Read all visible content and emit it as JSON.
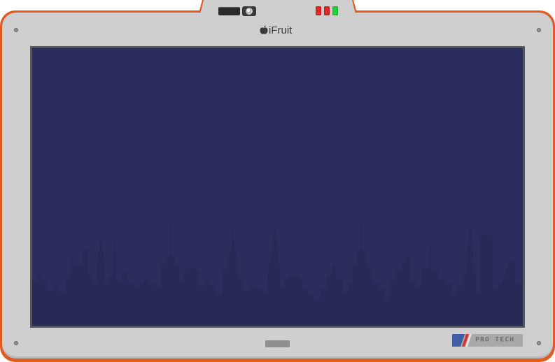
{
  "device": {
    "brand_name": "iFruit",
    "badge_text": "PRO TECH",
    "indicators": [
      "red",
      "red",
      "green"
    ]
  },
  "colors": {
    "rim": "#e05a22",
    "bezel": "#cfcfcf",
    "screen": "#2b2d5c",
    "skyline": "#272a55",
    "led_red": "#e02828",
    "led_green": "#27d13a"
  },
  "icons": {
    "brand": "fruit-logo-icon",
    "camera": "camera-icon"
  }
}
